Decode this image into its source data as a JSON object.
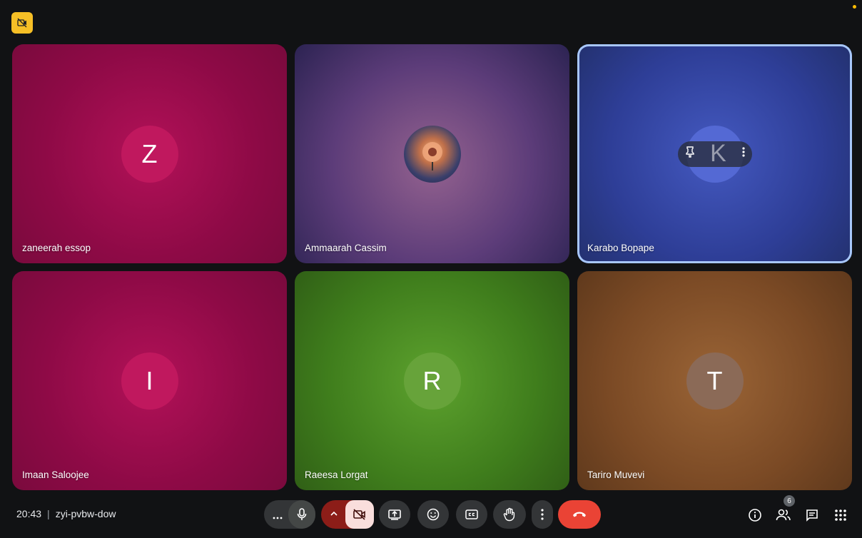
{
  "meeting": {
    "time": "20:43",
    "separator": "|",
    "code": "zyi-pvbw-dow"
  },
  "participants": [
    {
      "name": "zaneerah essop",
      "initial": "Z",
      "avatar_color": "#c0185e"
    },
    {
      "name": "Ammaarah Cassim",
      "initial": "",
      "avatar_color": "#6a4a7a"
    },
    {
      "name": "Karabo Bopape",
      "initial": "K",
      "avatar_color": "#5469d4"
    },
    {
      "name": "Imaan Saloojee",
      "initial": "I",
      "avatar_color": "#c0185e"
    },
    {
      "name": "Raeesa Lorgat",
      "initial": "R",
      "avatar_color": "#67a33a"
    },
    {
      "name": "Tariro Muvevi",
      "initial": "T",
      "avatar_color": "#8b6a57"
    }
  ],
  "people_count": "6",
  "controls": [
    "more-options",
    "microphone",
    "camera-options",
    "camera-off",
    "present-screen",
    "reactions",
    "captions",
    "raise-hand",
    "more-actions",
    "leave-call"
  ],
  "right_controls": [
    "meeting-details",
    "people",
    "chat",
    "activities"
  ],
  "colors": {
    "background": "#111214",
    "leave": "#ea4335",
    "camera_off_bg": "#f9dedc",
    "focus_ring": "#a8c7fa",
    "badge": "#f6bf26"
  }
}
